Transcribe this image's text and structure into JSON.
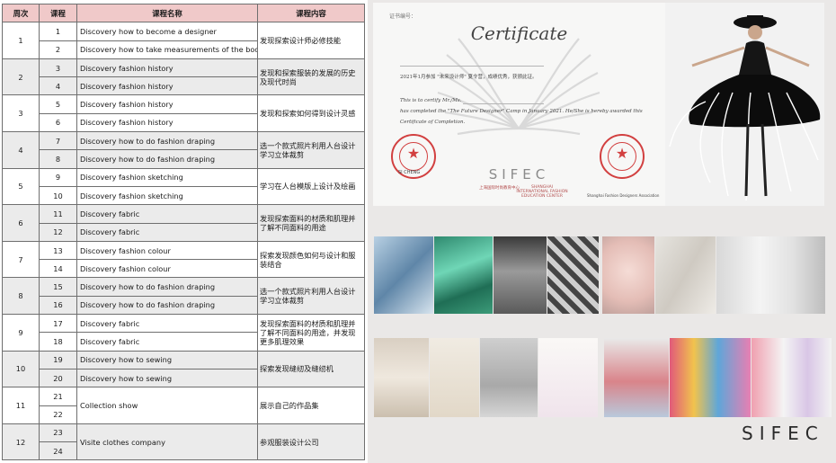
{
  "table": {
    "headers": [
      "周次",
      "课程",
      "课程名称",
      "课程内容"
    ],
    "weeks": [
      {
        "week": "1",
        "content": "发现探索设计师必修技能",
        "lessons": [
          {
            "no": "1",
            "name": "Discovery how to become a designer"
          },
          {
            "no": "2",
            "name": "Discovery how to take measurements of the body"
          }
        ]
      },
      {
        "week": "2",
        "content": "发现和探索服装的发展的历史及现代时尚",
        "lessons": [
          {
            "no": "3",
            "name": "Discovery fashion history"
          },
          {
            "no": "4",
            "name": "Discovery fashion history"
          }
        ]
      },
      {
        "week": "3",
        "content": "发现和探索如何得到设计灵感",
        "lessons": [
          {
            "no": "5",
            "name": "Discovery fashion history"
          },
          {
            "no": "6",
            "name": "Discovery fashion history"
          }
        ]
      },
      {
        "week": "4",
        "content": "选一个款式照片利用人台设计学习立体裁剪",
        "lessons": [
          {
            "no": "7",
            "name": "Discovery how to do fashion draping"
          },
          {
            "no": "8",
            "name": "Discovery how to do fashion draping"
          }
        ]
      },
      {
        "week": "5",
        "content": "学习在人台模版上设计及绘画",
        "lessons": [
          {
            "no": "9",
            "name": "Discovery fashion sketching"
          },
          {
            "no": "10",
            "name": "Discovery fashion sketching"
          }
        ]
      },
      {
        "week": "6",
        "content": "发现探索面料的材质和肌理并了解不同面料的用途",
        "lessons": [
          {
            "no": "11",
            "name": "Discovery fabric"
          },
          {
            "no": "12",
            "name": "Discovery fabric"
          }
        ]
      },
      {
        "week": "7",
        "content": "探索发现颜色如何与设计和服装结合",
        "lessons": [
          {
            "no": "13",
            "name": "Discovery fashion colour"
          },
          {
            "no": "14",
            "name": "Discovery fashion colour"
          }
        ]
      },
      {
        "week": "8",
        "content": "选一个款式照片利用人台设计学习立体裁剪",
        "lessons": [
          {
            "no": "15",
            "name": "Discovery how to do fashion draping"
          },
          {
            "no": "16",
            "name": "Discovery how to do fashion draping"
          }
        ]
      },
      {
        "week": "9",
        "content": "发现探索面料的材质和肌理并了解不同面料的用途，并发现更多肌理效果",
        "lessons": [
          {
            "no": "17",
            "name": "Discovery fabric"
          },
          {
            "no": "18",
            "name": "Discovery fabric"
          }
        ]
      },
      {
        "week": "10",
        "content": "探索发现缝纫及缝纫机",
        "lessons": [
          {
            "no": "19",
            "name": "Discovery how to sewing"
          },
          {
            "no": "20",
            "name": "Discovery how to sewing"
          }
        ]
      },
      {
        "week": "11",
        "content": "展示自己的作品集",
        "lessons": [
          {
            "no": "21",
            "name": "Collection  show"
          },
          {
            "no": "22",
            "name": ""
          }
        ]
      },
      {
        "week": "12",
        "content": "参观服装设计公司",
        "lessons": [
          {
            "no": "23",
            "name": "Visite clothes company"
          },
          {
            "no": "24",
            "name": ""
          }
        ]
      }
    ]
  },
  "certificate": {
    "number_label": "证书编号：",
    "title": "Certificate",
    "cn_line": "2021年1月参加 \"未来设计师\" 夏令营，成绩优秀，获颁此证。",
    "en_line1": "This is to certify Mr./Ms.",
    "en_line2": "has completed the \"The Future Designer\" Camp in January 2021. He/She is hereby awarded this",
    "en_line3": "Certificate of Completion.",
    "brand": "SIFEC",
    "brand_sub_cn": "上海国际时尚教育中心",
    "brand_sub_en": "SHANGHAI INTERNATIONAL FASHION EDUCATION CENTER",
    "seal_left_label": "SI CHENG",
    "seal_right_label": "Shanghai Fashion Designers Association",
    "seal_color": "#d24040"
  },
  "logo": "SIFEC",
  "colors": {
    "header_bg": "#f0c9c9",
    "row_gray": "#ebebeb",
    "panel_bg": "#eae8e7"
  }
}
